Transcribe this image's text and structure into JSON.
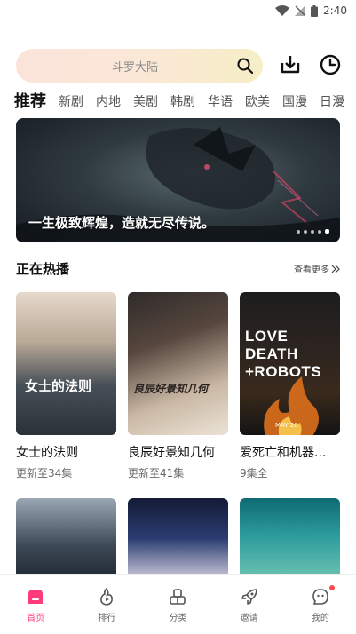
{
  "status": {
    "time": "2:40"
  },
  "search": {
    "placeholder": "斗罗大陆"
  },
  "tabs": [
    "推荐",
    "新剧",
    "内地",
    "美剧",
    "韩剧",
    "华语",
    "欧美",
    "国漫",
    "日漫"
  ],
  "banner": {
    "caption": "一生极致辉煌，造就无尽传说。",
    "dots": 5,
    "active_dot": 4
  },
  "section": {
    "title": "正在热播",
    "more": "查看更多"
  },
  "cards": [
    {
      "title": "女士的法则",
      "sub": "更新至34集",
      "poster_text": "女士的法则"
    },
    {
      "title": "良辰好景知几何",
      "sub": "更新至41集",
      "poster_text": "良辰好景知几何"
    },
    {
      "title": "爱死亡和机器...",
      "sub": "9集全",
      "poster_text": "LOVE DEATH +ROBOTS",
      "poster_date": "MAY 20"
    }
  ],
  "bottom_nav": [
    {
      "label": "首页",
      "icon": "home-icon",
      "active": true
    },
    {
      "label": "排行",
      "icon": "flame-icon"
    },
    {
      "label": "分类",
      "icon": "category-icon"
    },
    {
      "label": "邀请",
      "icon": "rocket-icon"
    },
    {
      "label": "我的",
      "icon": "chat-face-icon",
      "badge": true
    }
  ],
  "colors": {
    "accent": "#ff3b7a",
    "badge": "#ff4b4b"
  }
}
